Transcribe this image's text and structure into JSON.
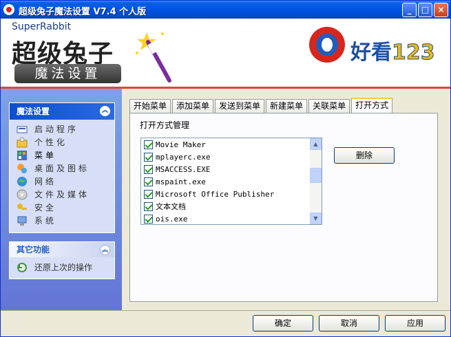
{
  "window": {
    "title": "超级兔子魔法设置 V7.4 个人版",
    "controls": [
      "minimize",
      "maximize",
      "close"
    ]
  },
  "banner": {
    "brand_top": "SuperRabbit",
    "brand_main": "超级兔子",
    "brand_sub": "魔法设置",
    "logo_text": "好看",
    "logo_number": "123"
  },
  "sidebar": {
    "section1_title": "魔法设置",
    "items": [
      {
        "label": "启动程序",
        "icon": "startup-icon"
      },
      {
        "label": "个性化",
        "icon": "personalize-icon"
      },
      {
        "label": "菜单",
        "icon": "menu-icon"
      },
      {
        "label": "桌面及图标",
        "icon": "desktop-icon"
      },
      {
        "label": "网络",
        "icon": "network-icon"
      },
      {
        "label": "文件及媒体",
        "icon": "media-icon"
      },
      {
        "label": "安全",
        "icon": "security-icon"
      },
      {
        "label": "系统",
        "icon": "system-icon"
      }
    ],
    "section2_title": "其它功能",
    "section2_item": "还原上次的操作"
  },
  "tabs": [
    "开始菜单",
    "添加菜单",
    "发送到菜单",
    "新建菜单",
    "关联菜单",
    "打开方式"
  ],
  "active_tab": "打开方式",
  "panel": {
    "title": "打开方式管理",
    "list_items": [
      {
        "label": "Movie Maker",
        "checked": true
      },
      {
        "label": "mplayerc.exe",
        "checked": true
      },
      {
        "label": "MSACCESS.EXE",
        "checked": true
      },
      {
        "label": "mspaint.exe",
        "checked": true
      },
      {
        "label": "Microsoft Office Publisher",
        "checked": true
      },
      {
        "label": "文本文档",
        "checked": true
      },
      {
        "label": "ois.exe",
        "checked": true
      }
    ],
    "delete_label": "删除"
  },
  "footer": {
    "ok_label": "确定",
    "cancel_label": "取消",
    "apply_label": "应用"
  }
}
